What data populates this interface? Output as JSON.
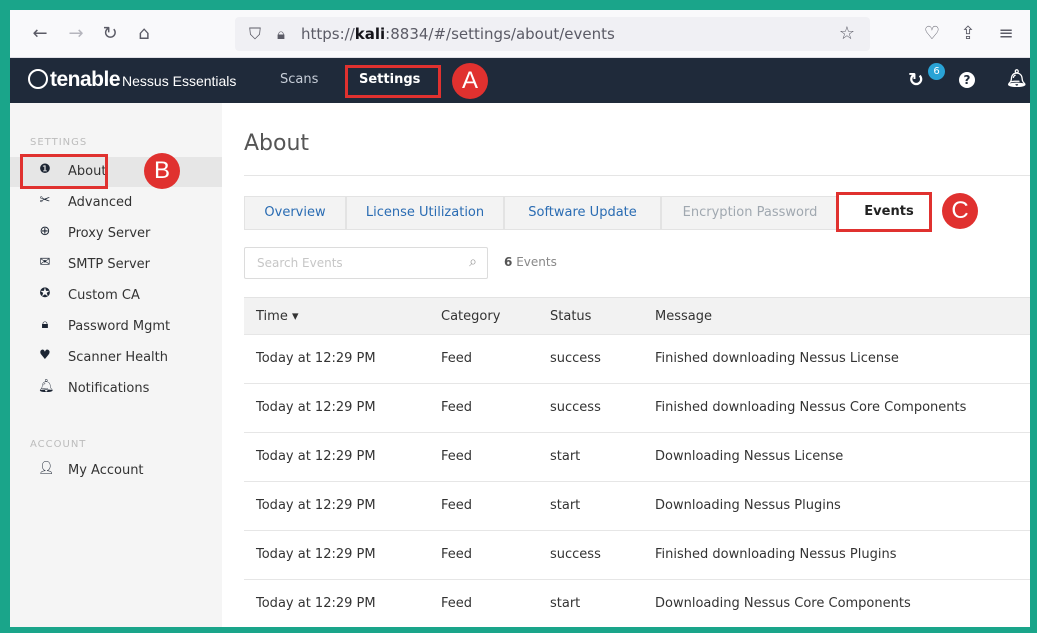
{
  "browser": {
    "url_prefix": "https://",
    "url_host": "kali",
    "url_rest": ":8834/#/settings/about/events"
  },
  "header": {
    "brand": "tenable",
    "product": "Nessus Essentials",
    "nav": [
      {
        "label": "Scans"
      },
      {
        "label": "Settings"
      }
    ],
    "notification_count": "6"
  },
  "callouts": [
    "A",
    "B",
    "C"
  ],
  "sidebar": {
    "settings_heading": "SETTINGS",
    "account_heading": "ACCOUNT",
    "items": [
      {
        "label": "About",
        "icon": "info-circle-icon"
      },
      {
        "label": "Advanced",
        "icon": "tools-icon"
      },
      {
        "label": "Proxy Server",
        "icon": "globe-icon"
      },
      {
        "label": "SMTP Server",
        "icon": "envelope-icon"
      },
      {
        "label": "Custom CA",
        "icon": "certificate-icon"
      },
      {
        "label": "Password Mgmt",
        "icon": "lock-icon"
      },
      {
        "label": "Scanner Health",
        "icon": "heartbeat-icon"
      },
      {
        "label": "Notifications",
        "icon": "bell-icon"
      }
    ],
    "account_items": [
      {
        "label": "My Account",
        "icon": "user-icon"
      }
    ]
  },
  "main": {
    "title": "About",
    "tabs": [
      {
        "label": "Overview"
      },
      {
        "label": "License Utilization"
      },
      {
        "label": "Software Update"
      },
      {
        "label": "Encryption Password"
      },
      {
        "label": "Events"
      }
    ],
    "search_placeholder": "Search Events",
    "event_count": "6",
    "event_count_label": "Events",
    "columns": [
      "Time ▾",
      "Category",
      "Status",
      "Message"
    ],
    "rows": [
      {
        "time": "Today at 12:29 PM",
        "category": "Feed",
        "status": "success",
        "message": "Finished downloading Nessus License"
      },
      {
        "time": "Today at 12:29 PM",
        "category": "Feed",
        "status": "success",
        "message": "Finished downloading Nessus Core Components"
      },
      {
        "time": "Today at 12:29 PM",
        "category": "Feed",
        "status": "start",
        "message": "Downloading Nessus License"
      },
      {
        "time": "Today at 12:29 PM",
        "category": "Feed",
        "status": "start",
        "message": "Downloading Nessus Plugins"
      },
      {
        "time": "Today at 12:29 PM",
        "category": "Feed",
        "status": "success",
        "message": "Finished downloading Nessus Plugins"
      },
      {
        "time": "Today at 12:29 PM",
        "category": "Feed",
        "status": "start",
        "message": "Downloading Nessus Core Components"
      }
    ]
  },
  "colors": {
    "frame": "#1aa58a",
    "header_bg": "#1f2a3a",
    "highlight": "#e0312f",
    "link": "#2a6cb3"
  }
}
